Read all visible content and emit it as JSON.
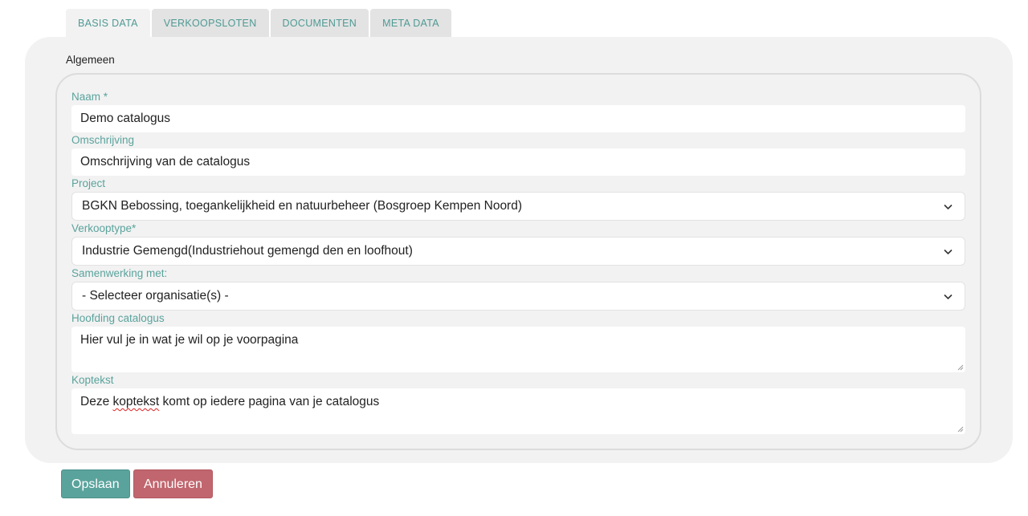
{
  "tabs": [
    {
      "label": "BASIS DATA",
      "active": true
    },
    {
      "label": "VERKOOPSLOTEN",
      "active": false
    },
    {
      "label": "DOCUMENTEN",
      "active": false
    },
    {
      "label": "META DATA",
      "active": false
    }
  ],
  "section": {
    "title": "Algemeen"
  },
  "form": {
    "naam": {
      "label": "Naam *",
      "value": "Demo catalogus"
    },
    "omschrijving": {
      "label": "Omschrijving",
      "value": "Omschrijving van de catalogus"
    },
    "project": {
      "label": "Project",
      "value": "BGKN Bebossing, toegankelijkheid en natuurbeheer (Bosgroep Kempen Noord)"
    },
    "verkooptype": {
      "label": "Verkooptype*",
      "value": "Industrie Gemengd(Industriehout gemengd den en loofhout)"
    },
    "samenwerking": {
      "label": "Samenwerking met:",
      "value": "- Selecteer organisatie(s) -"
    },
    "hoofding": {
      "label": "Hoofding catalogus",
      "value": "Hier vul je in wat je wil op je voorpagina"
    },
    "koptekst": {
      "label": "Koptekst",
      "value_before": "Deze ",
      "value_misspelled": "koptekst",
      "value_after": " komt op iedere pagina van je catalogus"
    }
  },
  "buttons": {
    "save": "Opslaan",
    "cancel": "Annuleren"
  },
  "icons": {
    "select_arrow": "chevron-down-icon",
    "resize": "resize-grip-icon"
  },
  "colors": {
    "accent": "#5aa39c",
    "danger": "#c1666e",
    "panel": "#f2f2f2",
    "tab_inactive": "#e3e3e3"
  }
}
